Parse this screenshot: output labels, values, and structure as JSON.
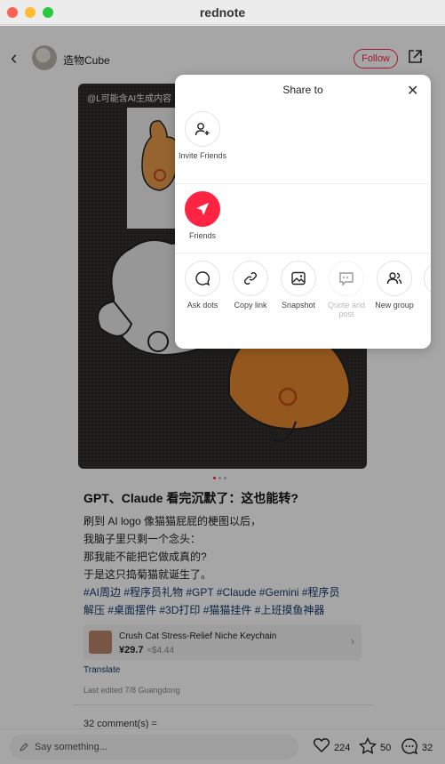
{
  "window": {
    "title": "rednote"
  },
  "header": {
    "author": "造物Cube",
    "follow_label": "Follow"
  },
  "photo": {
    "watermark": "@L可能含AI生成内容"
  },
  "post": {
    "title": "GPT、Claude 看完沉默了：这也能转?",
    "lines": [
      "刷到 AI logo 像猫猫屁屁的梗图以后，",
      "我脑子里只剩一个念头：",
      "那我能不能把它做成真的?",
      "于是这只捣菊猫就诞生了。"
    ],
    "tags_line1": "#AI周边 #程序员礼物 #GPT #Claude #Gemini #程序员",
    "tags_line2": "解压 #桌面摆件 #3D打印 #猫猫挂件 #上班摸鱼神器",
    "product": {
      "name": "Crush Cat Stress-Relief Niche Keychain",
      "price": "¥29.7",
      "converted": "≈$4.44"
    },
    "translate_label": "Translate",
    "edited": "Last edited 7/8 Guangdong",
    "comments_label": "32 comment(s) ="
  },
  "bottom_bar": {
    "placeholder": "Say something...",
    "likes": "224",
    "stars": "50",
    "comments": "32"
  },
  "share_sheet": {
    "title": "Share to",
    "invite": "Invite Friends",
    "friends": "Friends",
    "actions": [
      "Ask dots",
      "Copy link",
      "Snapshot",
      "Quote and post",
      "New group"
    ]
  },
  "colors": {
    "accent": "#ff2442",
    "tag": "#13386c"
  }
}
